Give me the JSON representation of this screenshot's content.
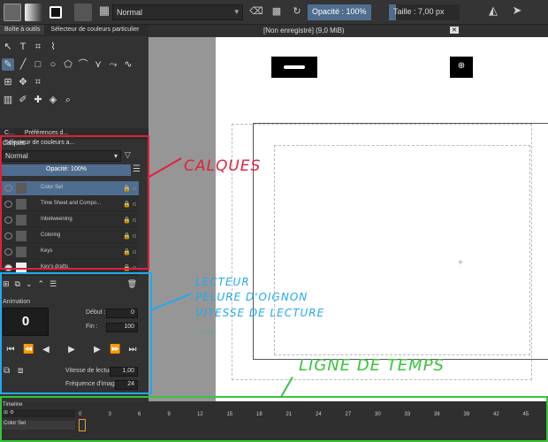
{
  "toolbar": {
    "blend_mode": "Normal",
    "opacity_label": "Opacité : 100%",
    "size_label": "Taille : 7,00 px",
    "colors": {
      "accent": "#4f6d8f"
    }
  },
  "left_docker": {
    "tabs": [
      "Boîte à outils",
      "Sélecteur de couleurs particulier"
    ],
    "sub_tabs": [
      "C...",
      "Préférences d...",
      "Sélecteur de couleurs a..."
    ]
  },
  "layers": {
    "title": "Calques",
    "blend_mode": "Normal",
    "opacity_label": "Opacité:  100%",
    "items": [
      {
        "name": "Color Set",
        "selected": true
      },
      {
        "name": "Time Sheet and Compo...",
        "selected": false
      },
      {
        "name": "Inbetweening",
        "selected": false
      },
      {
        "name": "Coloring",
        "selected": false
      },
      {
        "name": "Keys",
        "selected": false
      },
      {
        "name": "Key's drafts",
        "selected": false
      }
    ]
  },
  "animation": {
    "title": "Animation",
    "current_frame": "0",
    "start_label": "Début :",
    "start_value": "0",
    "end_label": "Fin :",
    "end_value": "100",
    "speed_label": "Vitesse de lecture :",
    "speed_value": "1,00",
    "fps_label": "Fréquence d'images :",
    "fps_value": "24"
  },
  "canvas": {
    "doc_title": "[Non enregistré]  (9,0 MiB)"
  },
  "timeline": {
    "title": "Timeline",
    "layer_name": "Color Set",
    "ticks": [
      "0",
      "3",
      "6",
      "9",
      "12",
      "15",
      "18",
      "21",
      "24",
      "27",
      "30",
      "33",
      "36",
      "39",
      "42",
      "45"
    ]
  },
  "annotations": {
    "calques": "CALQUES",
    "lecteur_1": "LECTEUR",
    "lecteur_2": "PELURE D'OIGNON",
    "lecteur_3": "VITESSE DE LECTURE",
    "lecteur_4": "...",
    "timeline": "LIGNE DE TEMPS",
    "colors": {
      "red": "#e0203a",
      "blue": "#1fa9f2",
      "green": "#39c43a"
    }
  }
}
